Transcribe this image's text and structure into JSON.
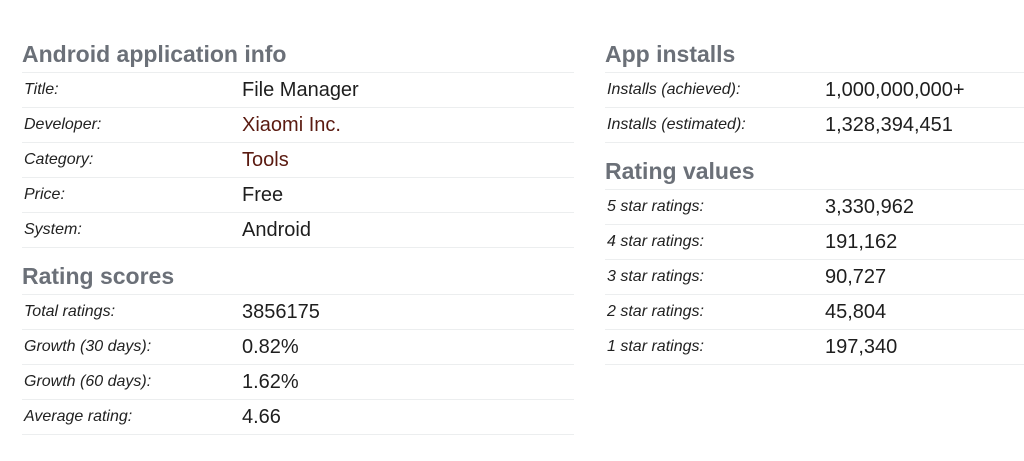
{
  "android_info": {
    "title": "Android application info",
    "rows": [
      {
        "label": "Title:",
        "value": "File Manager"
      },
      {
        "label": "Developer:",
        "value": "Xiaomi Inc."
      },
      {
        "label": "Category:",
        "value": "Tools"
      },
      {
        "label": "Price:",
        "value": "Free"
      },
      {
        "label": "System:",
        "value": "Android"
      }
    ]
  },
  "rating_scores": {
    "title": "Rating scores",
    "rows": [
      {
        "label": "Total ratings:",
        "value": "3856175"
      },
      {
        "label": "Growth (30 days):",
        "value": "0.82%"
      },
      {
        "label": "Growth (60 days):",
        "value": "1.62%"
      },
      {
        "label": "Average rating:",
        "value": "4.66"
      }
    ]
  },
  "app_installs": {
    "title": "App installs",
    "rows": [
      {
        "label": "Installs (achieved):",
        "value": "1,000,000,000+"
      },
      {
        "label": "Installs (estimated):",
        "value": "1,328,394,451"
      }
    ]
  },
  "rating_values": {
    "title": "Rating values",
    "rows": [
      {
        "label": "5 star ratings:",
        "value": "3,330,962"
      },
      {
        "label": "4 star ratings:",
        "value": "191,162"
      },
      {
        "label": "3 star ratings:",
        "value": "90,727"
      },
      {
        "label": "2 star ratings:",
        "value": "45,804"
      },
      {
        "label": "1 star ratings:",
        "value": "197,340"
      }
    ]
  },
  "colors": {
    "heading": "#6b7078",
    "link": "#5a1a10",
    "divider": "#eceeef"
  }
}
